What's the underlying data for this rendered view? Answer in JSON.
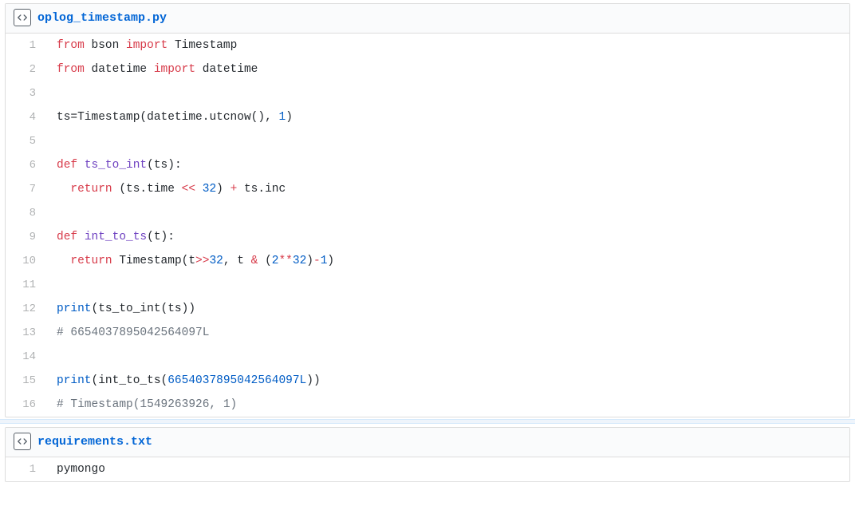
{
  "files": [
    {
      "name": "oplog_timestamp.py",
      "lines": [
        [
          {
            "t": "from",
            "c": "pl-k"
          },
          {
            "t": " bson "
          },
          {
            "t": "import",
            "c": "pl-k"
          },
          {
            "t": " Timestamp"
          }
        ],
        [
          {
            "t": "from",
            "c": "pl-k"
          },
          {
            "t": " datetime "
          },
          {
            "t": "import",
            "c": "pl-k"
          },
          {
            "t": " datetime"
          }
        ],
        [],
        [
          {
            "t": "ts"
          },
          {
            "t": "="
          },
          {
            "t": "Timestamp("
          },
          {
            "t": "datetime"
          },
          {
            "t": "."
          },
          {
            "t": "utcnow"
          },
          {
            "t": "(), "
          },
          {
            "t": "1",
            "c": "pl-c1"
          },
          {
            "t": ")"
          }
        ],
        [],
        [
          {
            "t": "def",
            "c": "pl-k"
          },
          {
            "t": " "
          },
          {
            "t": "ts_to_int",
            "c": "pl-en"
          },
          {
            "t": "(ts):"
          }
        ],
        [
          {
            "t": "  "
          },
          {
            "t": "return",
            "c": "pl-k"
          },
          {
            "t": " (ts.time "
          },
          {
            "t": "<<",
            "c": "pl-k"
          },
          {
            "t": " "
          },
          {
            "t": "32",
            "c": "pl-c1"
          },
          {
            "t": ") "
          },
          {
            "t": "+",
            "c": "pl-k"
          },
          {
            "t": " ts.inc"
          }
        ],
        [],
        [
          {
            "t": "def",
            "c": "pl-k"
          },
          {
            "t": " "
          },
          {
            "t": "int_to_ts",
            "c": "pl-en"
          },
          {
            "t": "(t):"
          }
        ],
        [
          {
            "t": "  "
          },
          {
            "t": "return",
            "c": "pl-k"
          },
          {
            "t": " Timestamp(t"
          },
          {
            "t": ">>",
            "c": "pl-k"
          },
          {
            "t": "32",
            "c": "pl-c1"
          },
          {
            "t": ", t "
          },
          {
            "t": "&",
            "c": "pl-k"
          },
          {
            "t": " ("
          },
          {
            "t": "2",
            "c": "pl-c1"
          },
          {
            "t": "**",
            "c": "pl-k"
          },
          {
            "t": "32",
            "c": "pl-c1"
          },
          {
            "t": ")"
          },
          {
            "t": "-",
            "c": "pl-k"
          },
          {
            "t": "1",
            "c": "pl-c1"
          },
          {
            "t": ")"
          }
        ],
        [],
        [
          {
            "t": "print",
            "c": "pl-c1"
          },
          {
            "t": "(ts_to_int(ts))"
          }
        ],
        [
          {
            "t": "# 6654037895042564097L",
            "c": "pl-c"
          }
        ],
        [],
        [
          {
            "t": "print",
            "c": "pl-c1"
          },
          {
            "t": "(int_to_ts("
          },
          {
            "t": "6654037895042564097L",
            "c": "pl-c1"
          },
          {
            "t": "))"
          }
        ],
        [
          {
            "t": "# Timestamp(1549263926, 1)",
            "c": "pl-c"
          }
        ]
      ]
    },
    {
      "name": "requirements.txt",
      "lines": [
        [
          {
            "t": "pymongo"
          }
        ]
      ]
    }
  ]
}
